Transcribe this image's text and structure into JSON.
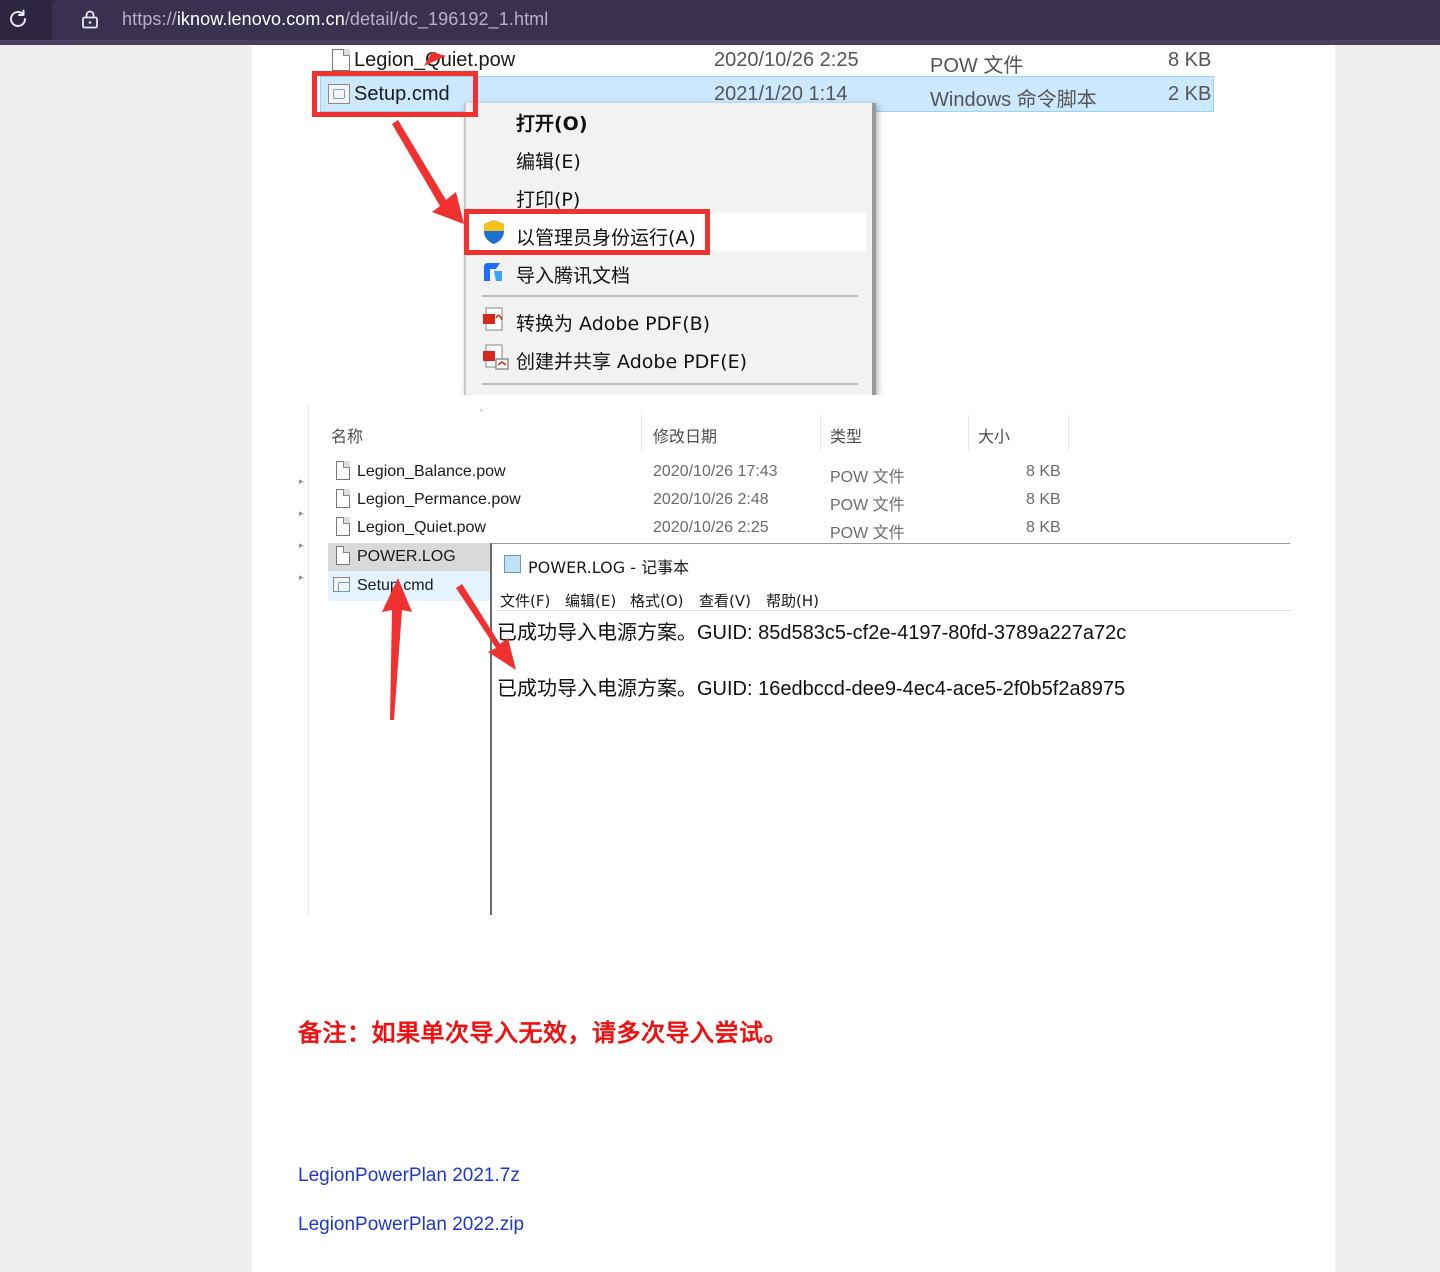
{
  "browser": {
    "url_prefix": "https://",
    "url_host": "iknow.lenovo.com.cn",
    "url_path": "/detail/dc_196192_1.html"
  },
  "shot1": {
    "rows": [
      {
        "name": "Legion_Quiet.pow",
        "date": "2020/10/26 2:25",
        "type": "POW 文件",
        "size": "8 KB"
      },
      {
        "name": "Setup.cmd",
        "date": "2021/1/20 1:14",
        "type": "Windows 命令脚本",
        "size": "2 KB"
      }
    ],
    "context_menu": {
      "open": "打开(O)",
      "edit": "编辑(E)",
      "print": "打印(P)",
      "run_as_admin": "以管理员身份运行(A)",
      "import_tencent": "导入腾讯文档",
      "convert_pdf": "转换为 Adobe PDF(B)",
      "create_share_pdf": "创建并共享 Adobe PDF(E)"
    }
  },
  "shot2": {
    "headers": {
      "name": "名称",
      "date": "修改日期",
      "type": "类型",
      "size": "大小"
    },
    "rows": [
      {
        "name": "Legion_Balance.pow",
        "date": "2020/10/26 17:43",
        "type": "POW 文件",
        "size": "8 KB"
      },
      {
        "name": "Legion_Permance.pow",
        "date": "2020/10/26 2:48",
        "type": "POW 文件",
        "size": "8 KB"
      },
      {
        "name": "Legion_Quiet.pow",
        "date": "2020/10/26 2:25",
        "type": "POW 文件",
        "size": "8 KB"
      },
      {
        "name": "POWER.LOG"
      },
      {
        "name": "Setup.cmd"
      }
    ]
  },
  "notepad": {
    "title": "POWER.LOG - 记事本",
    "menu": [
      "文件(F)",
      "编辑(E)",
      "格式(O)",
      "查看(V)",
      "帮助(H)"
    ],
    "lines": [
      "已成功导入电源方案。GUID: 85d583c5-cf2e-4197-80fd-3789a227a72c",
      "已成功导入电源方案。GUID: 16edbccd-dee9-4ec4-ace5-2f0b5f2a8975"
    ]
  },
  "note": "备注：如果单次导入无效，请多次导入尝试。",
  "downloads": [
    "LegionPowerPlan 2021.7z",
    "LegionPowerPlan 2022.zip"
  ],
  "colors": {
    "accent_red": "#f0312f",
    "link": "#1f38c9",
    "selection": "#cce8ff"
  }
}
